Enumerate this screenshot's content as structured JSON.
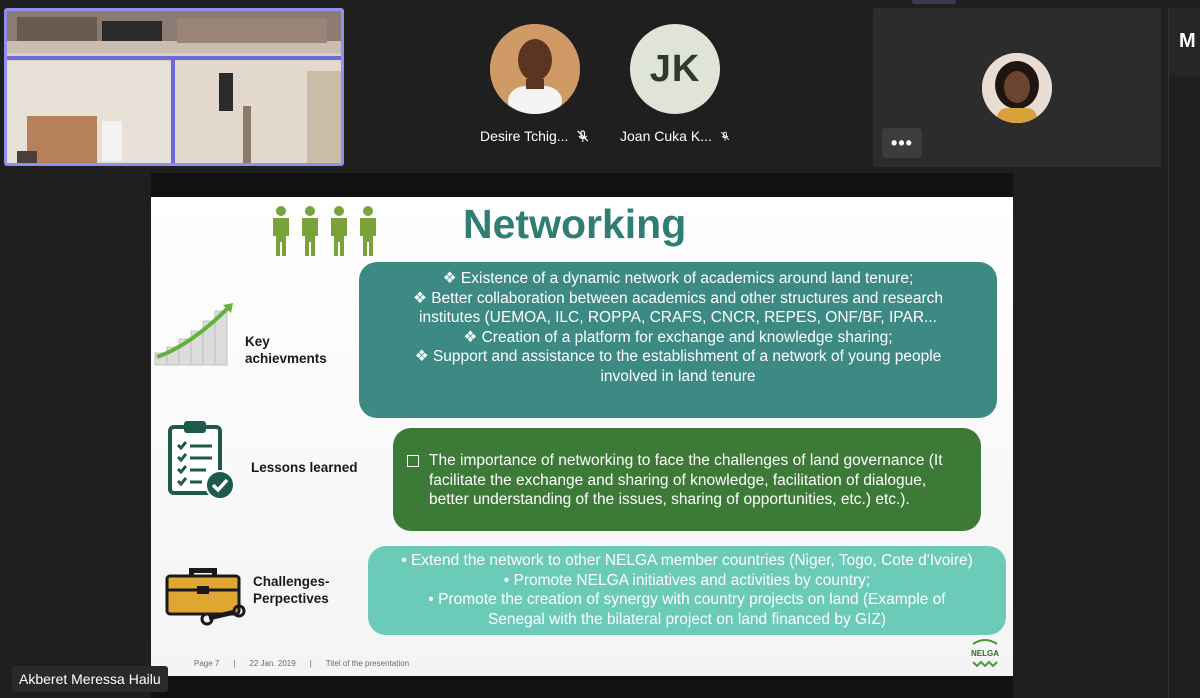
{
  "participants": [
    {
      "name": "Desire Tchig...",
      "muted": true
    },
    {
      "name": "Joan Cuka K...",
      "initials": "JK",
      "muted": true
    }
  ],
  "more_button": "•••",
  "edge_panel_letter": "M",
  "active_speaker": "Akberet Meressa Hailu",
  "slide": {
    "title": "Networking",
    "sections": {
      "achievements_label": [
        "Key",
        "achievments"
      ],
      "achievements": [
        "❖  Existence of a dynamic network of academics around land tenure;",
        "❖  Better collaboration between academics and other structures and research",
        "institutes (UEMOA, ILC, ROPPA, CRAFS, CNCR, REPES, ONF/BF, IPAR...",
        "❖  Creation of a platform for exchange and knowledge sharing;",
        "❖  Support and assistance to the establishment of a network of young people",
        "involved in land tenure"
      ],
      "lessons_label": "Lessons learned",
      "lessons": "The importance of networking to face the challenges of land governance (It facilitate the exchange and sharing of knowledge, facilitation of dialogue, better understanding of the issues, sharing of opportunities, etc.)  etc.).",
      "challenges_label": [
        "Challenges-",
        "Perpectives"
      ],
      "challenges": [
        "•   Extend the network to other NELGA member countries (Niger, Togo, Cote d'Ivoire)",
        "•   Promote NELGA initiatives and activities by country;",
        "•   Promote the creation of synergy with country projects on land (Example of",
        "Senegal with the bilateral project on land financed by GIZ)"
      ]
    },
    "footer": {
      "page": "Page 7",
      "sep1": "|",
      "date": "22 Jan. 2019",
      "sep2": "|",
      "title": "Titel of the presentation"
    },
    "logo_text": "NELGA"
  },
  "colors": {
    "title": "#2f7d73",
    "achievements_box": "#3d8a84",
    "lessons_box": "#3d7a38",
    "challenges_box": "#6ccab9",
    "active_border": "#8f8ff0"
  }
}
